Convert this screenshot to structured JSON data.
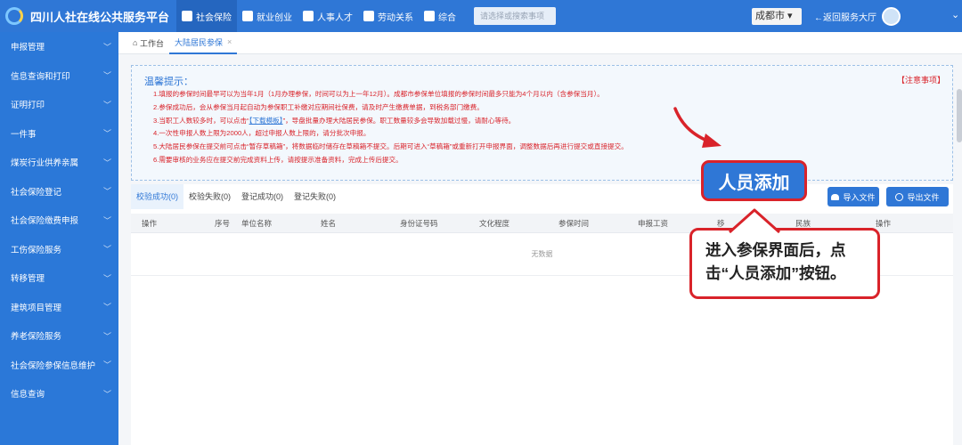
{
  "header": {
    "app_title": "四川人社在线公共服务平台",
    "nav": [
      {
        "label": "社会保险",
        "icon": "shield-icon",
        "active": true
      },
      {
        "label": "就业创业",
        "icon": "briefcase-icon",
        "active": false
      },
      {
        "label": "人事人才",
        "icon": "people-icon",
        "active": false
      },
      {
        "label": "劳动关系",
        "icon": "document-icon",
        "active": false
      },
      {
        "label": "综合",
        "icon": "layers-icon",
        "active": false
      }
    ],
    "search_placeholder": "请选择或搜索事项",
    "city": "成都市",
    "back_label": "←返回服务大厅"
  },
  "sidebar": {
    "items": [
      {
        "label": "申报管理"
      },
      {
        "label": "信息查询和打印"
      },
      {
        "label": "证明打印"
      },
      {
        "label": "一件事"
      },
      {
        "label": "煤炭行业供养亲属"
      },
      {
        "label": "社会保险登记"
      },
      {
        "label": "社会保险缴费申报"
      },
      {
        "label": "工伤保险服务"
      },
      {
        "label": "转移管理"
      },
      {
        "label": "建筑项目管理"
      },
      {
        "label": "养老保险服务"
      },
      {
        "label": "社会保险参保信息维护"
      },
      {
        "label": "信息查询"
      }
    ]
  },
  "tabs": {
    "workbench": "工作台",
    "current": "大陆居民参保",
    "close": "×"
  },
  "tips": {
    "title": "温馨提示：",
    "note_link": "【注意事项】",
    "line1": "1.填报的参保时间最早可以为当年1月（1月办理参保，时间可以为上一年12月）。成都市参保单位填报的参保时间最多只能为4个月以内（含参保当月）。",
    "line2": "2.参保成功后，会从参保当月起自动为参保职工补缴对应期间社保费，请及时产生缴费单据，到税务部门缴费。",
    "line3_pre": "3.当职工人数较多时，可以点击“",
    "line3_link": "【下载模板】",
    "line3_post": "”，导盘批量办理大陆居民参保。职工数量较多会导致加载过慢，请耐心等待。",
    "line4": "4.一次性申报人数上限为2000人，超过申报人数上限的，请分批次申报。",
    "line5": "5.大陆居民参保在提交前可点击“暂存草稿箱”，将数据临时储存在草稿箱不提交。后期可进入“草稿箱”或重新打开申报界面，调整数据后再进行提交或直接提交。",
    "line6": "6.需要审核的业务应在提交前完成资料上传，请按提示准备资料，完成上传后提交。"
  },
  "panel": {
    "status_tabs": [
      "校验成功(0)",
      "校验失败(0)",
      "登记成功(0)",
      "登记失败(0)"
    ],
    "import_label": "导入文件",
    "export_label": "导出文件",
    "columns": [
      "操作",
      "序号",
      "单位名称",
      "姓名",
      "身份证号码",
      "文化程度",
      "参保时间",
      "申报工资",
      "移",
      "民族",
      "操作"
    ],
    "empty_text": "无数据"
  },
  "annotations": {
    "highlight_label": "人员添加",
    "note_line1": "进入参保界面后，点",
    "note_line2": "击“人员添加”按钮。"
  },
  "colors": {
    "brand_blue": "#2f77d6",
    "annotation_red": "#d9232a",
    "tip_background": "#f3f8fd"
  }
}
